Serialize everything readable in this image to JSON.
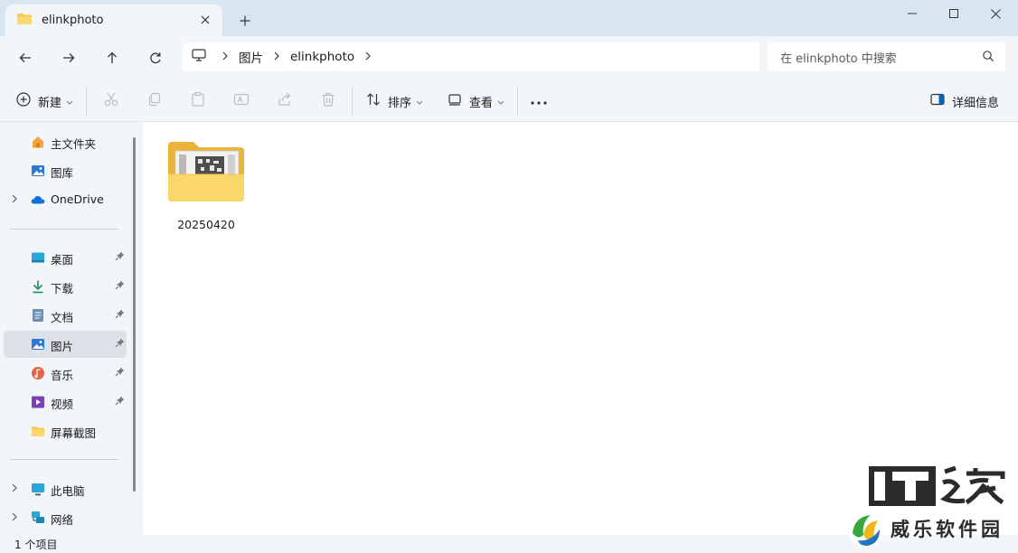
{
  "window": {
    "tab_title": "elinkphoto",
    "minimize_label": "minimize",
    "maximize_label": "maximize",
    "close_label": "close"
  },
  "address": {
    "crumbs": [
      "图片",
      "elinkphoto"
    ]
  },
  "search": {
    "placeholder": "在 elinkphoto 中搜索"
  },
  "commands": {
    "new_label": "新建",
    "sort_label": "排序",
    "view_label": "查看",
    "details_label": "详细信息"
  },
  "sidebar": {
    "top": [
      {
        "label": "主文件夹",
        "icon": "home-icon"
      },
      {
        "label": "图库",
        "icon": "gallery-icon"
      },
      {
        "label": "OneDrive",
        "icon": "cloud-icon"
      }
    ],
    "quick": [
      {
        "label": "桌面",
        "icon": "desktop-icon"
      },
      {
        "label": "下载",
        "icon": "download-icon"
      },
      {
        "label": "文档",
        "icon": "document-icon"
      },
      {
        "label": "图片",
        "icon": "pictures-icon"
      },
      {
        "label": "音乐",
        "icon": "music-icon"
      },
      {
        "label": "视频",
        "icon": "video-icon"
      },
      {
        "label": "屏幕截图",
        "icon": "folder-icon"
      }
    ],
    "bottom": [
      {
        "label": "此电脑",
        "icon": "computer-icon"
      },
      {
        "label": "网络",
        "icon": "network-icon"
      }
    ]
  },
  "content": {
    "items": [
      {
        "name": "20250420",
        "type": "folder"
      }
    ]
  },
  "status": {
    "text": "1 个项目"
  },
  "watermark": {
    "it": "IT",
    "jia": "之家",
    "sub": "威乐软件园"
  },
  "colors": {
    "accent": "#0067c0",
    "folder": "#f8c94a",
    "titlebar": "#d9e6f0",
    "chrome": "#f3f6f9"
  }
}
